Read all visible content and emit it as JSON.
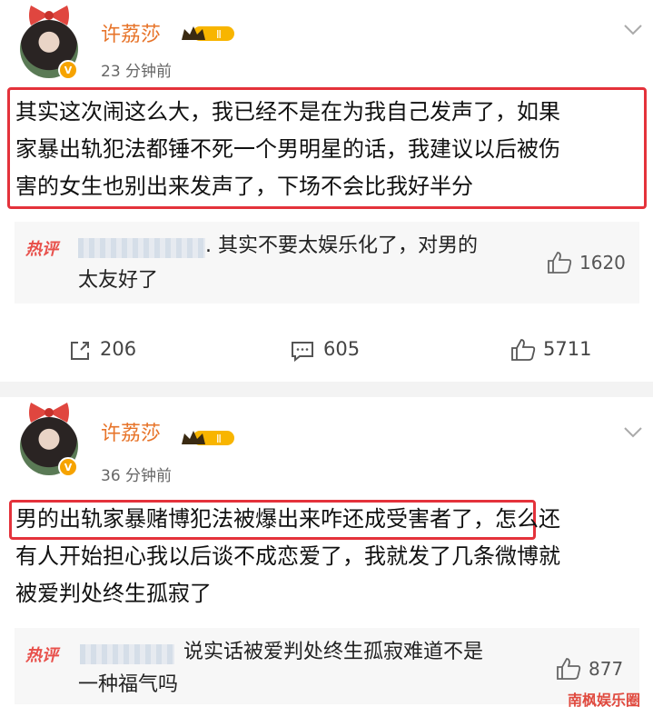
{
  "posts": [
    {
      "username": "许荔莎",
      "vip_level": "Ⅱ",
      "time": "23 分钟前",
      "content_lines": [
        "其实这次闹这么大，我已经不是在为我自己发声了，如果",
        "家暴出轨犯法都锤不死一个男明星的话，我建议以后被伤",
        "害的女生也别出来发声了，下场不会比我好半分"
      ],
      "hot_comment": {
        "label": "热评",
        "text_line1": ". 其实不要太娱乐化了，对男的",
        "text_line2": "太友好了",
        "likes": "1620"
      },
      "actions": {
        "reposts": "206",
        "comments": "605",
        "likes": "5711"
      }
    },
    {
      "username": "许荔莎",
      "vip_level": "Ⅱ",
      "time": "36 分钟前",
      "content_line1_boxed": "男的出轨家暴赌博犯法被爆出来咋还成受害者了",
      "content_line1_rest": "，怎么还",
      "content_line2": "有人开始担心我以后谈不成恋爱了，我就发了几条微博就",
      "content_line3": "被爱判处终生孤寂了",
      "hot_comment": {
        "label": "热评",
        "text_line1": "说实话被爱判处终生孤寂难道不是",
        "text_line2": "一种福气吗",
        "likes": "877"
      }
    }
  ],
  "watermark": "南枫娱乐圈",
  "colors": {
    "username": "#e7742a",
    "highlight_box": "#e4323b",
    "hot_label": "#e8504b",
    "verified_badge": "#f6a300"
  }
}
